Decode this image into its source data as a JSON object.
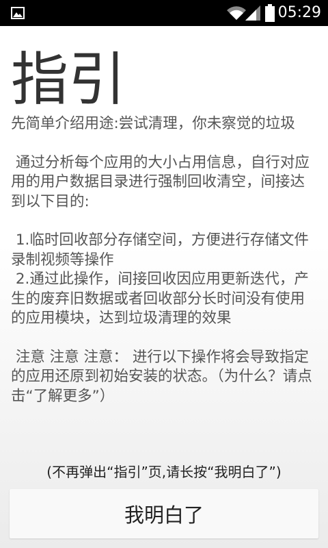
{
  "status_bar": {
    "time": "05:29",
    "left_icon": "image-icon",
    "right_icons": [
      "wifi-icon",
      "signal-icon",
      "battery-icon"
    ],
    "background": "#000000",
    "foreground": "#ffffff"
  },
  "guide": {
    "title": "指引",
    "paragraphs": [
      "先简单介绍用途:尝试清理，你未察觉的垃圾",
      " 通过分析每个应用的大小占用信息，自行对应用的用户数据目录进行强制回收清空，间接达到以下目的:",
      " 1.临时回收部分存储空间，方便进行存储文件录制视频等操作",
      " 2.通过此操作，间接回收因应用更新迭代，产生的废弃旧数据或者回收部分长时间没有使用的应用模块，达到垃圾清理的效果",
      " 注意 注意 注意： 进行以下操作将会导致指定的应用还原到初始安装的状态。（为什么？请点击“了解更多”）"
    ],
    "hint": "(不再弹出“指引”页,请长按“我明白了”)",
    "confirm_label": "我明白了"
  }
}
